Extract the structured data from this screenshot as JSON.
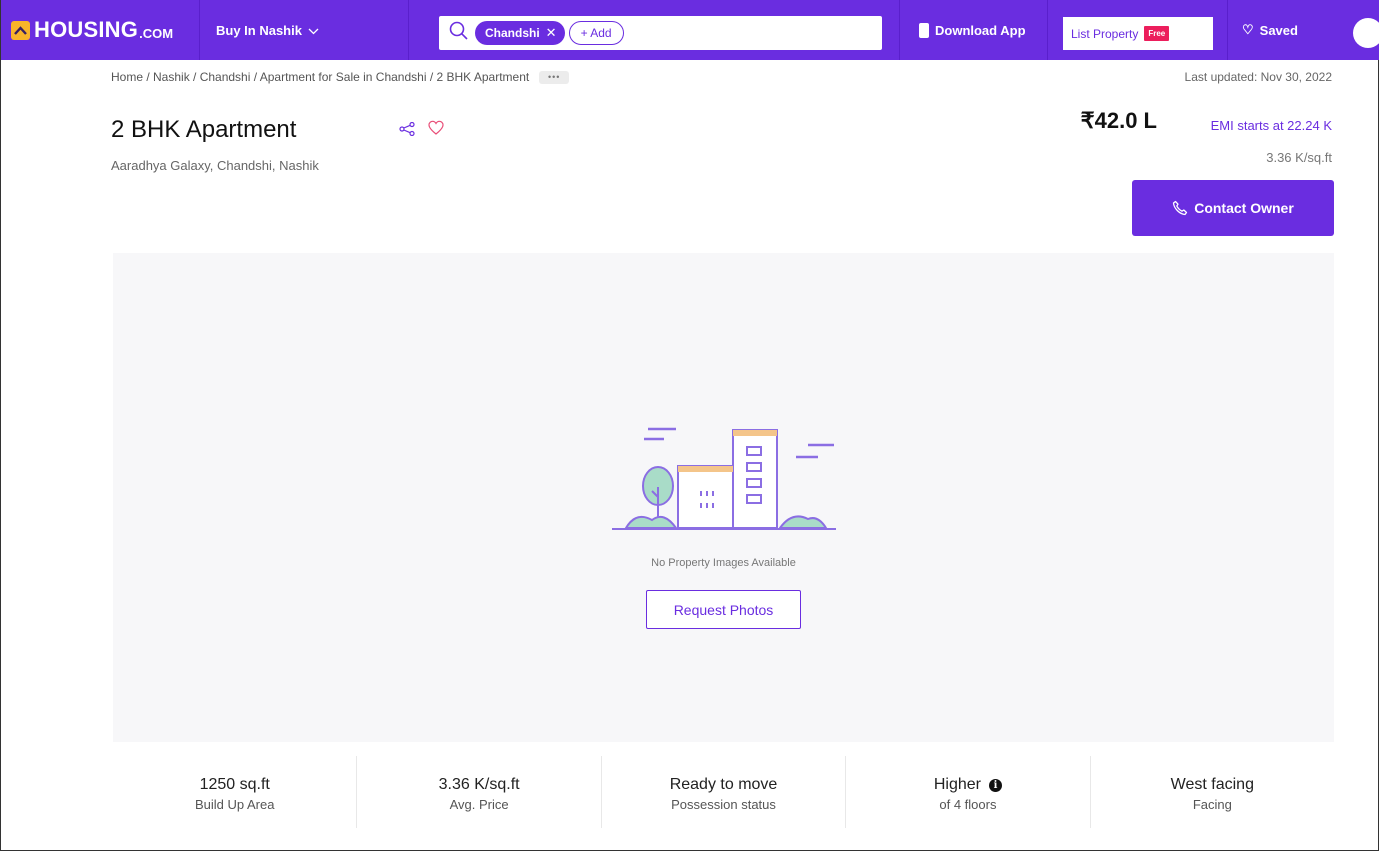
{
  "header": {
    "logo_text": "HOUSING",
    "logo_suffix": ".COM",
    "city_select": "Buy In Nashik",
    "search_chip": "Chandshi",
    "add_chip": "+ Add",
    "download_app": "Download App",
    "list_property": "List Property",
    "free_badge": "Free",
    "saved": "Saved",
    "brand_color": "#6a2de0"
  },
  "breadcrumb": {
    "text": "Home / Nashik / Chandshi / Apartment for Sale in Chandshi / 2 BHK Apartment",
    "more": "•••"
  },
  "last_updated": "Last updated: Nov 30, 2022",
  "listing": {
    "title": "2 BHK Apartment",
    "subtitle": "Aaradhya Galaxy, Chandshi, Nashik",
    "price": "₹42.0 L",
    "emi": "EMI starts at  22.24 K",
    "per_sqft": "3.36 K/sq.ft",
    "contact_button": "Contact Owner"
  },
  "gallery": {
    "empty_text": "No Property Images Available",
    "request_button": "Request Photos"
  },
  "stats": [
    {
      "value": "1250 sq.ft",
      "label": "Build Up Area"
    },
    {
      "value": "3.36 K/sq.ft",
      "label": "Avg. Price"
    },
    {
      "value": "Ready to move",
      "label": "Possession status"
    },
    {
      "value": "Higher",
      "label": "of 4 floors"
    },
    {
      "value": "West facing",
      "label": "Facing"
    }
  ]
}
